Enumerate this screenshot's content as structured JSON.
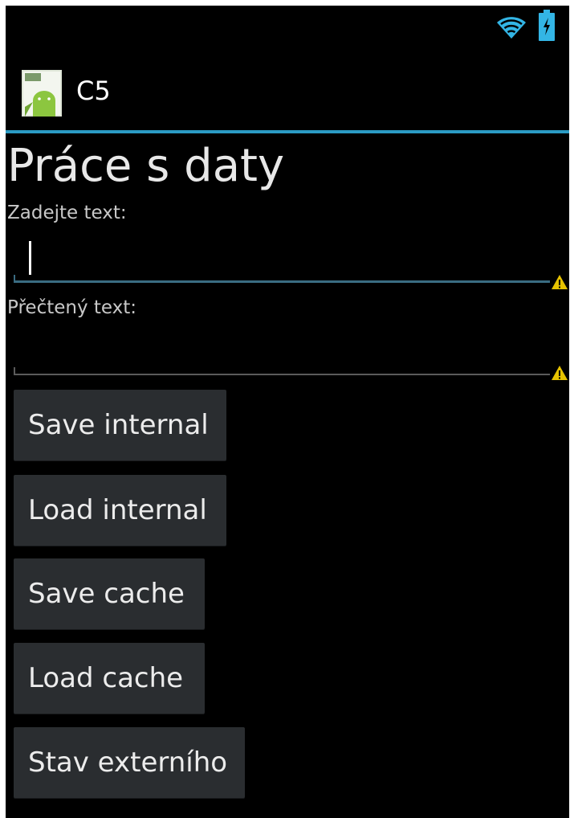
{
  "app": {
    "title": "C5"
  },
  "status_bar": {
    "icons": [
      "wifi-icon",
      "battery-charging-icon"
    ]
  },
  "content": {
    "heading": "Práce s daty",
    "input_label": "Zadejte text:",
    "input_value": "",
    "read_label": "Přečtený text:",
    "read_value": ""
  },
  "buttons": {
    "save_internal": "Save internal",
    "load_internal": "Load internal",
    "save_cache": "Save cache",
    "load_cache": "Load cache",
    "external_state": "Stav externího"
  },
  "colors": {
    "accent": "#2b9bc4",
    "background": "#000000",
    "button": "#2a2d30",
    "warning": "#e6c200"
  }
}
